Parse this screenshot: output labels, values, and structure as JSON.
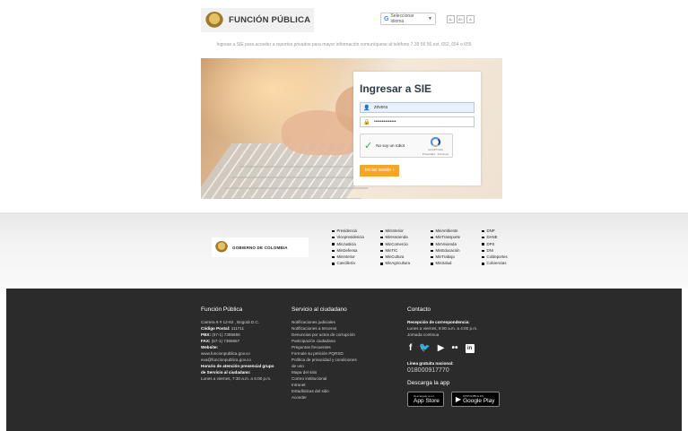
{
  "header": {
    "logo_text": "FUNCIÓN PÚBLICA",
    "language_selector": {
      "icon_letter": "G",
      "label": "Seleccionar idioma",
      "arrow": "▼"
    },
    "accessibility": [
      "A-",
      "A+",
      "A"
    ],
    "notice": "Ingrese a SIE para acceder a reportes privados para mayor información comuníquese al teléfono 7 39 56 56 ext. 652, 654 o 655"
  },
  "login": {
    "title": "Ingresar a SIE",
    "username_icon": "👤",
    "username_value": "zrivera",
    "password_icon": "🔒",
    "password_value": "••••••••••••••",
    "captcha": {
      "check": "✓",
      "label": "No soy un robot",
      "brand": "reCAPTCHA",
      "terms": "Privacidad - Términos"
    },
    "submit_label": "Iniciar sesión ›"
  },
  "gov_band": {
    "logo_text": "GOBIERNO DE COLOMBIA",
    "links": [
      "Presidencia",
      "MinInterior",
      "MinAmbiente",
      "DNP",
      "Vicepresidencia",
      "MinHacienda",
      "MinTransporte",
      "DANE",
      "MinJusticia",
      "MinComercio",
      "MinVivienda",
      "DPS",
      "MinDefensa",
      "MinTIC",
      "MinEducación",
      "DNI",
      "MinInterior",
      "MinCultura",
      "MinTrabajo",
      "Coldeportes",
      "Cancillería",
      "MinAgricultura",
      "MinSalud",
      "Colciencias"
    ]
  },
  "footer": {
    "col1": {
      "title": "Función Pública",
      "lines": [
        {
          "text": "Carrera 6 # 12-62 , Bogotá D.C."
        },
        {
          "label": "Código Postal:",
          "text": " 111711"
        },
        {
          "label": "PBX:",
          "text": " (57-1) 7395656"
        },
        {
          "label": "FAX:",
          "text": " (57-1) 7395657"
        },
        {
          "label": "Website:",
          "text": ""
        },
        {
          "text": "www.funcionpublica.gov.co"
        },
        {
          "text": "eva@funcionpublica.gov.co"
        },
        {
          "label": "Horario de atención presencial grupo",
          "text": ""
        },
        {
          "label": "de Servicio al ciudadano:",
          "text": ""
        },
        {
          "text": "Lunes a viernes, 7:30 a.m. a 6:00 p.m."
        }
      ]
    },
    "col2": {
      "title": "Servicio al ciudadano",
      "links": [
        "Notificaciones judiciales",
        "Notificaciones a terceros",
        "Denuncias por actos de corrupción",
        "Participación ciudadana",
        "Preguntas frecuentes",
        "Formule su petición PQRSD",
        "Política de privacidad y condiciones",
        "de uso",
        "Mapa del sitio",
        "Correo institucional",
        "Intranet",
        "Estadísticas del sitio",
        "Acceder"
      ]
    },
    "col3": {
      "title": "Contacto",
      "reception_label": "Recepción de correspondencia:",
      "reception_lines": [
        "Lunes a viernes, 8:00 a.m. a 4:00 p.m.",
        "Jornada continua"
      ],
      "social": [
        "f",
        "🐦",
        "▶",
        "••",
        "in"
      ],
      "hotline_label": "Línea gratuita nacional:",
      "hotline": "018000917770",
      "app_title": "Descarga la app",
      "stores": [
        {
          "icon": "",
          "small": "Descárgalo en el",
          "big": "App Store"
        },
        {
          "icon": "▶",
          "small": "DISPONIBLE EN",
          "big": "Google Play"
        }
      ]
    }
  }
}
